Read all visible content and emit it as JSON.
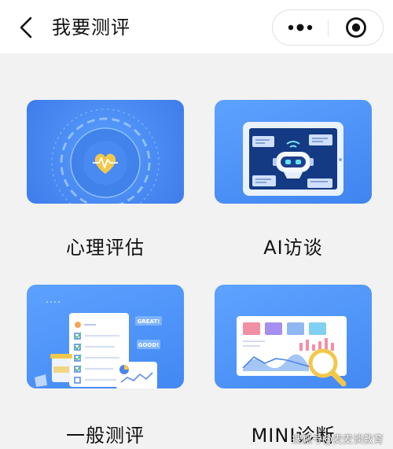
{
  "header": {
    "title": "我要测评",
    "back_icon": "chevron-left-icon",
    "more_icon": "more-dots-icon",
    "close_icon": "target-close-icon"
  },
  "cards": [
    {
      "label": "心理评估",
      "icon": "heart-radar-icon"
    },
    {
      "label": "AI访谈",
      "icon": "robot-tablet-icon"
    },
    {
      "label": "一般测评",
      "icon": "checklist-document-icon"
    },
    {
      "label": "MINI诊断",
      "icon": "dashboard-magnifier-icon"
    }
  ],
  "illustration_text": {
    "great": "GREAT!",
    "good": "GOOD!"
  },
  "watermark": "搜狐号@麦麦谈教育",
  "colors": {
    "card_blue": "#4f8ef5",
    "card_light": "#7fb3fb",
    "accent_yellow": "#f2c84b",
    "page_bg": "#f2f2f2"
  }
}
